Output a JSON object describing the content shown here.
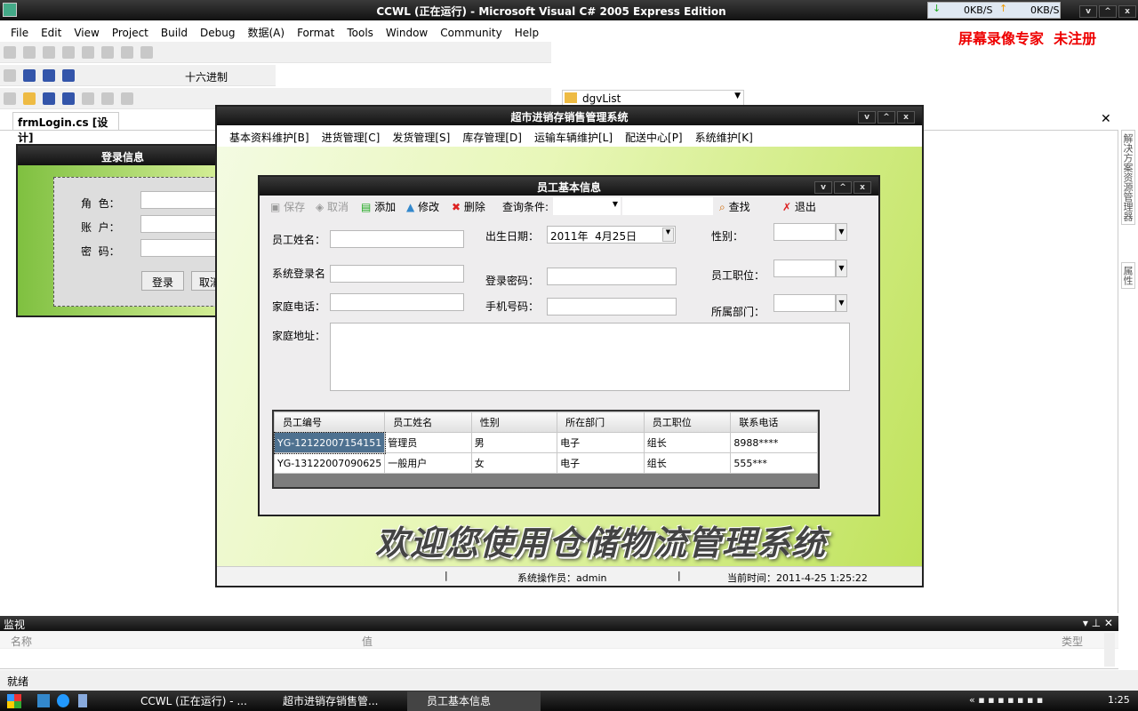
{
  "ide": {
    "title": "CCWL (正在运行) - Microsoft Visual C# 2005 Express Edition",
    "net": {
      "down": "0KB/S",
      "up": "0KB/S"
    },
    "watermark": "屏幕录像专家  未注册",
    "menu": [
      "File",
      "Edit",
      "View",
      "Project",
      "Build",
      "Debug",
      "数据(A)",
      "Format",
      "Tools",
      "Window",
      "Community",
      "Help"
    ],
    "hex_button": "十六进制",
    "object_combo": "dgvList",
    "doc_tab": "frmLogin.cs [设计]",
    "side_tabs": [
      "解决方案资源管理器",
      "属性"
    ],
    "watch": {
      "title": "监视",
      "cols": [
        "名称",
        "值",
        "类型"
      ]
    },
    "status": "就绪"
  },
  "login": {
    "title": "登录信息",
    "role": "角  色：",
    "account": "账  户：",
    "password": "密  码：",
    "login_btn": "登录",
    "cancel_btn": "取消"
  },
  "main": {
    "title": "超市进销存销售管理系统",
    "menu": [
      "基本资料维护[B]",
      "进货管理[C]",
      "发货管理[S]",
      "库存管理[D]",
      "运输车辆维护[L]",
      "配送中心[P]",
      "系统维护[K]"
    ],
    "banner": "欢迎您使用仓储物流管理系统",
    "operator": "系统操作员：admin",
    "time": "当前时间：2011-4-25 1:25:22"
  },
  "employee": {
    "title": "员工基本信息",
    "toolbar": {
      "save": "保存",
      "cancel": "取消",
      "add": "添加",
      "edit": "修改",
      "delete": "删除",
      "query": "查询条件:",
      "find": "查找",
      "exit": "退出"
    },
    "fields": {
      "name": "员工姓名：",
      "birth": "出生日期：",
      "birth_value": "2011年  4月25日",
      "gender": "性别：",
      "login": "系统登录名",
      "pwd": "登录密码：",
      "position": "员工职位：",
      "phone": "家庭电话：",
      "mobile": "手机号码：",
      "dept": "所属部门：",
      "address": "家庭地址："
    },
    "grid": {
      "cols": [
        "员工编号",
        "员工姓名",
        "性别",
        "所在部门",
        "员工职位",
        "联系电话"
      ],
      "rows": [
        [
          "YG-12122007154151",
          "管理员",
          "男",
          "电子",
          "组长",
          "8988****"
        ],
        [
          "YG-13122007090625",
          "一般用户",
          "女",
          "电子",
          "组长",
          "555***"
        ]
      ]
    }
  },
  "taskbar": {
    "items": [
      "CCWL (正在运行) - ...",
      "超市进销存销售管...",
      "员工基本信息"
    ],
    "clock": "1:25"
  }
}
